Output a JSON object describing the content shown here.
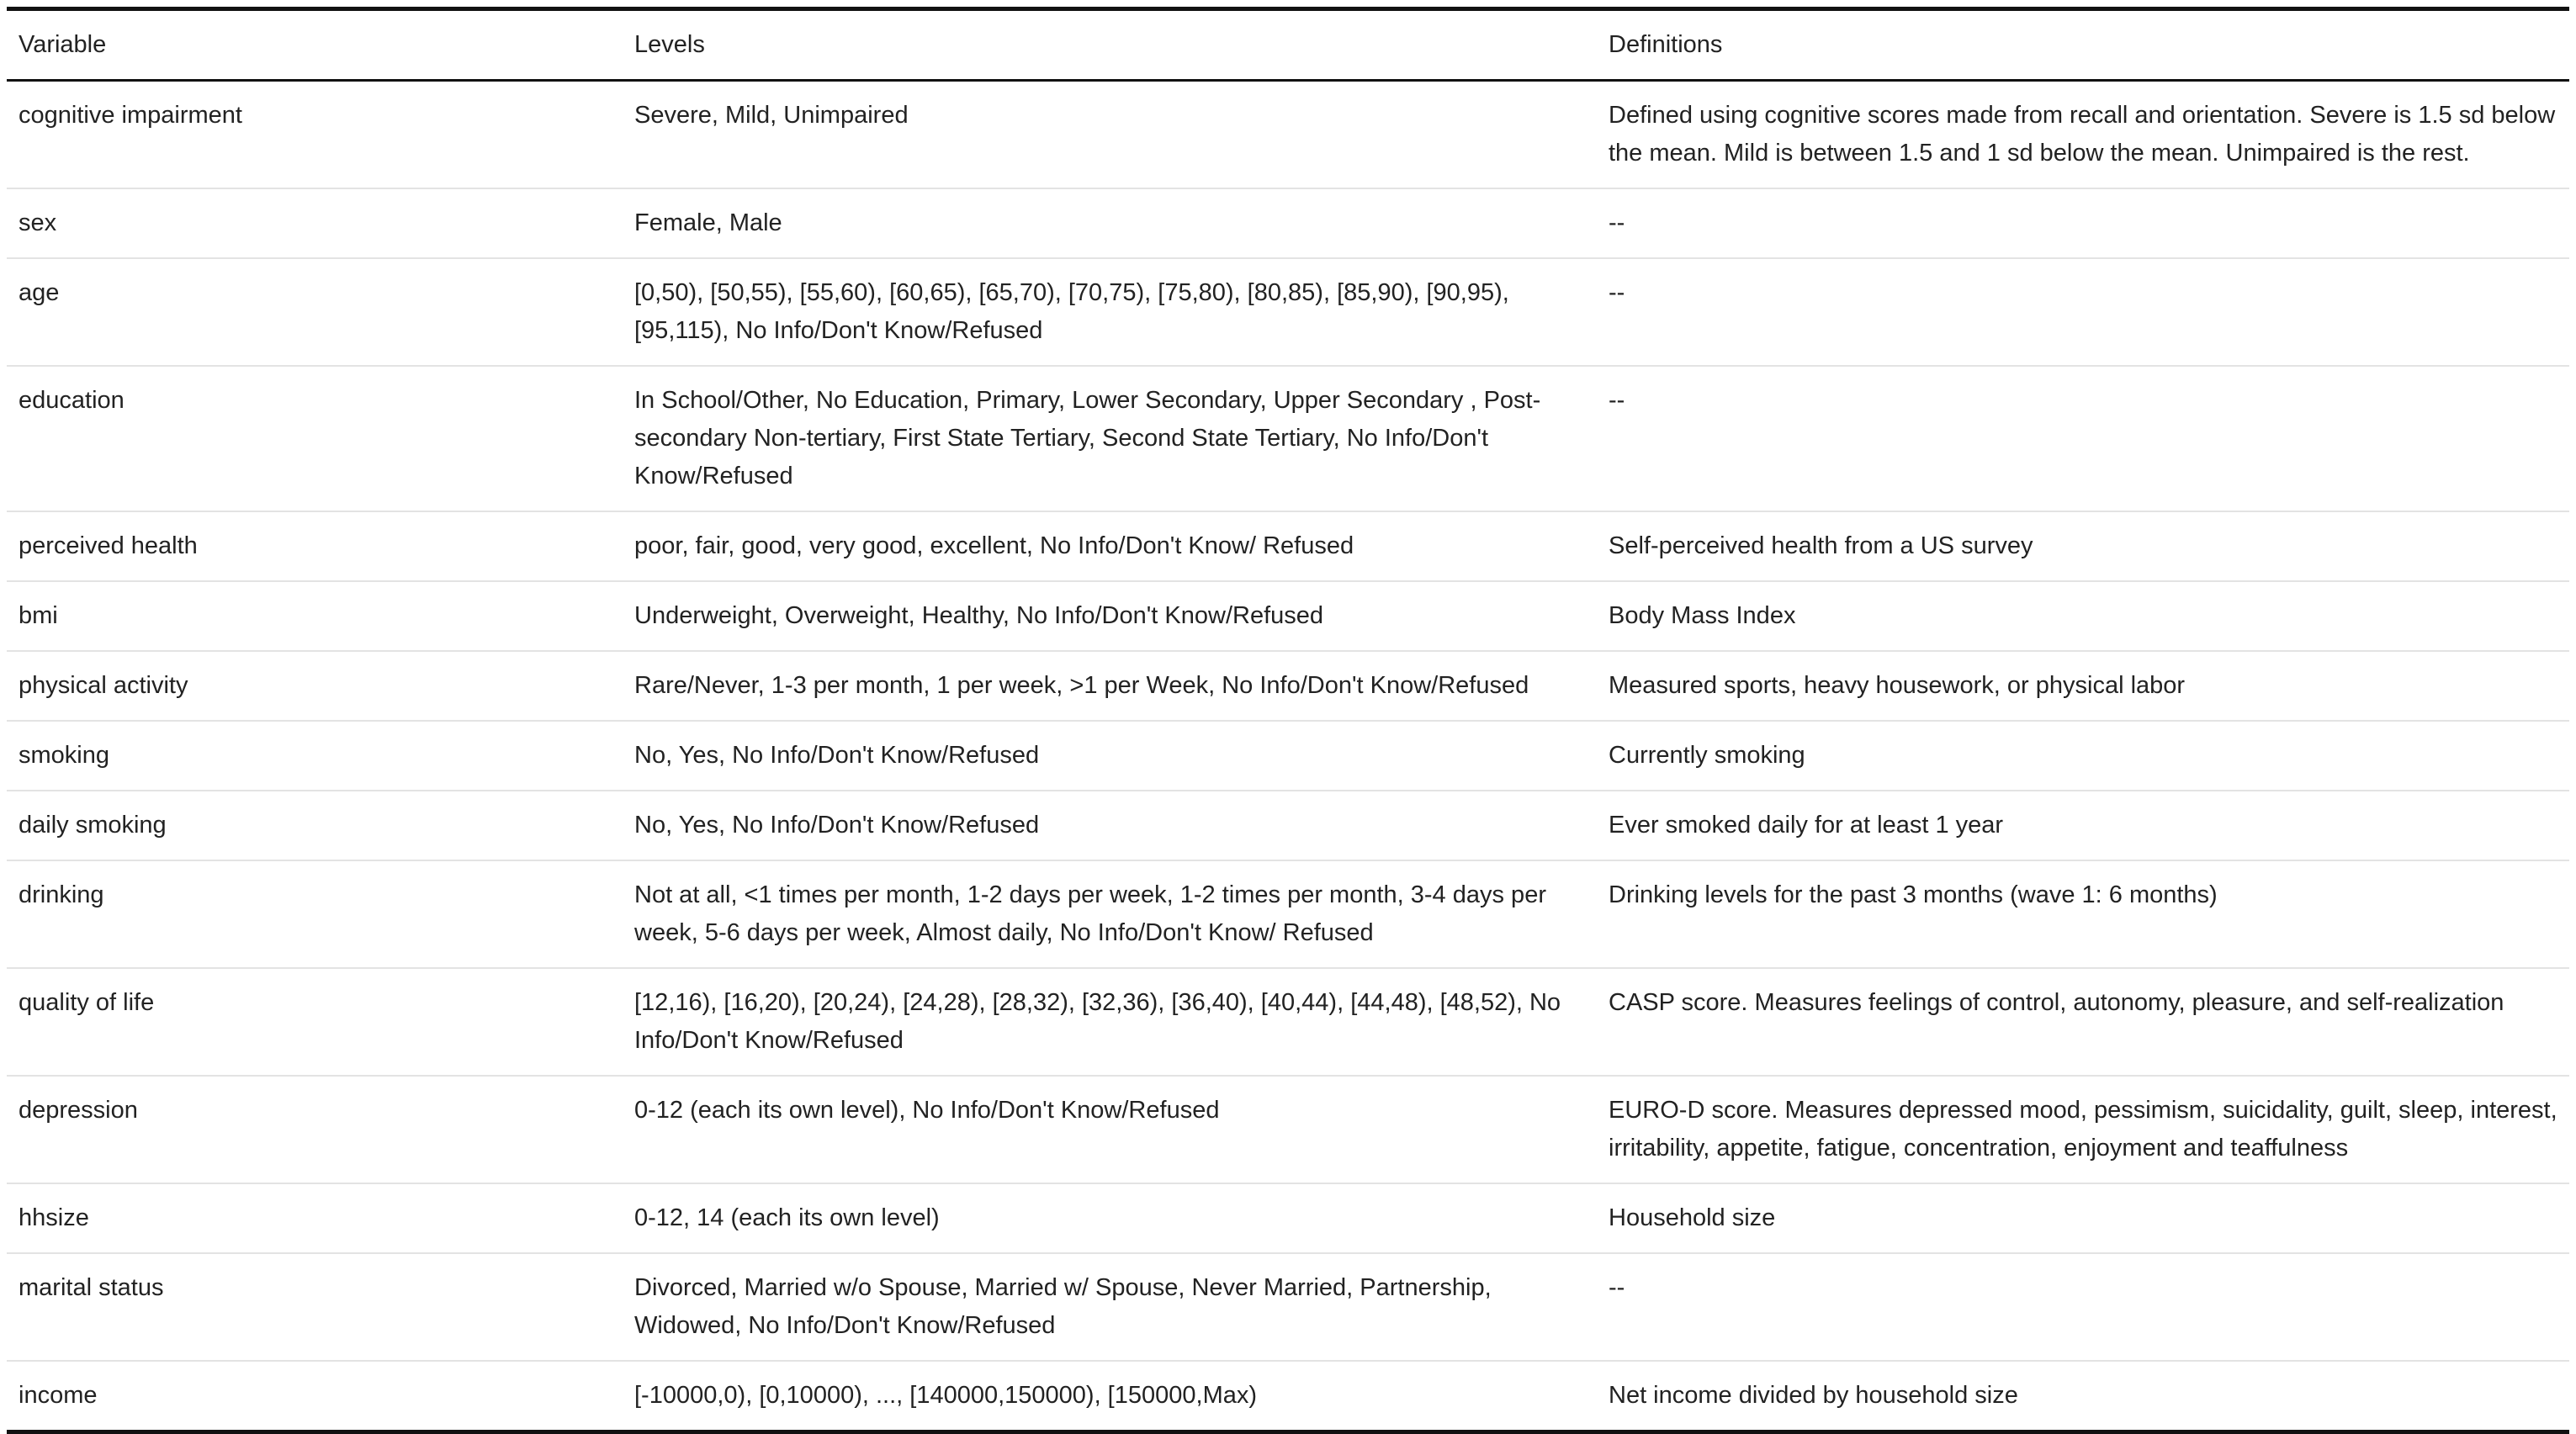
{
  "table": {
    "headers": [
      "Variable",
      "Levels",
      "Definitions"
    ],
    "rows": [
      {
        "variable": "cognitive impairment",
        "levels": "Severe, Mild, Unimpaired",
        "definition": "Defined using cognitive scores made from recall and orientation. Severe is 1.5 sd below the mean. Mild is between 1.5 and 1 sd below the mean. Unimpaired is the rest."
      },
      {
        "variable": "sex",
        "levels": "Female, Male",
        "definition": "--"
      },
      {
        "variable": "age",
        "levels": "[0,50), [50,55), [55,60), [60,65), [65,70), [70,75), [75,80), [80,85), [85,90), [90,95), [95,115), No Info/Don't Know/Refused",
        "definition": "--"
      },
      {
        "variable": "education",
        "levels": "In School/Other, No Education, Primary, Lower Secondary, Upper Secondary , Post-secondary Non-tertiary, First State Tertiary, Second State Tertiary, No Info/Don't Know/Refused",
        "definition": "--"
      },
      {
        "variable": "perceived health",
        "levels": "poor, fair, good, very good, excellent, No Info/Don't Know/ Refused",
        "definition": "Self-perceived health from a US survey"
      },
      {
        "variable": "bmi",
        "levels": "Underweight, Overweight, Healthy, No Info/Don't Know/Refused",
        "definition": "Body Mass Index"
      },
      {
        "variable": "physical activity",
        "levels": "Rare/Never, 1-3 per month, 1 per week, >1 per Week, No Info/Don't Know/Refused",
        "definition": "Measured sports, heavy housework, or physical labor"
      },
      {
        "variable": "smoking",
        "levels": "No, Yes, No Info/Don't Know/Refused",
        "definition": "Currently smoking"
      },
      {
        "variable": "daily smoking",
        "levels": "No, Yes, No Info/Don't Know/Refused",
        "definition": "Ever smoked daily for at least 1 year"
      },
      {
        "variable": "drinking",
        "levels": "Not at all, <1 times per month, 1-2 days per week, 1-2 times per month, 3-4 days per week, 5-6 days per week, Almost daily, No Info/Don't Know/ Refused",
        "definition": "Drinking levels for the past 3 months (wave 1: 6 months)"
      },
      {
        "variable": "quality of life",
        "levels": "[12,16), [16,20), [20,24), [24,28), [28,32), [32,36), [36,40), [40,44), [44,48), [48,52), No Info/Don't Know/Refused",
        "definition": "CASP score. Measures feelings of control, autonomy, pleasure, and self-realization"
      },
      {
        "variable": "depression",
        "levels": "0-12 (each its own level), No Info/Don't Know/Refused",
        "definition": "EURO-D score. Measures depressed mood, pessimism, suicidality, guilt, sleep, interest, irritability, appetite, fatigue, concentration, enjoyment and teaffulness"
      },
      {
        "variable": "hhsize",
        "levels": "0-12, 14 (each its own level)",
        "definition": "Household size"
      },
      {
        "variable": "marital status",
        "levels": "Divorced, Married w/o Spouse, Married w/ Spouse, Never Married, Partnership, Widowed, No Info/Don't Know/Refused",
        "definition": "--"
      },
      {
        "variable": "income",
        "levels": "[-10000,0), [0,10000), ..., [140000,150000), [150000,Max)",
        "definition": "Net income divided by household size"
      }
    ]
  }
}
